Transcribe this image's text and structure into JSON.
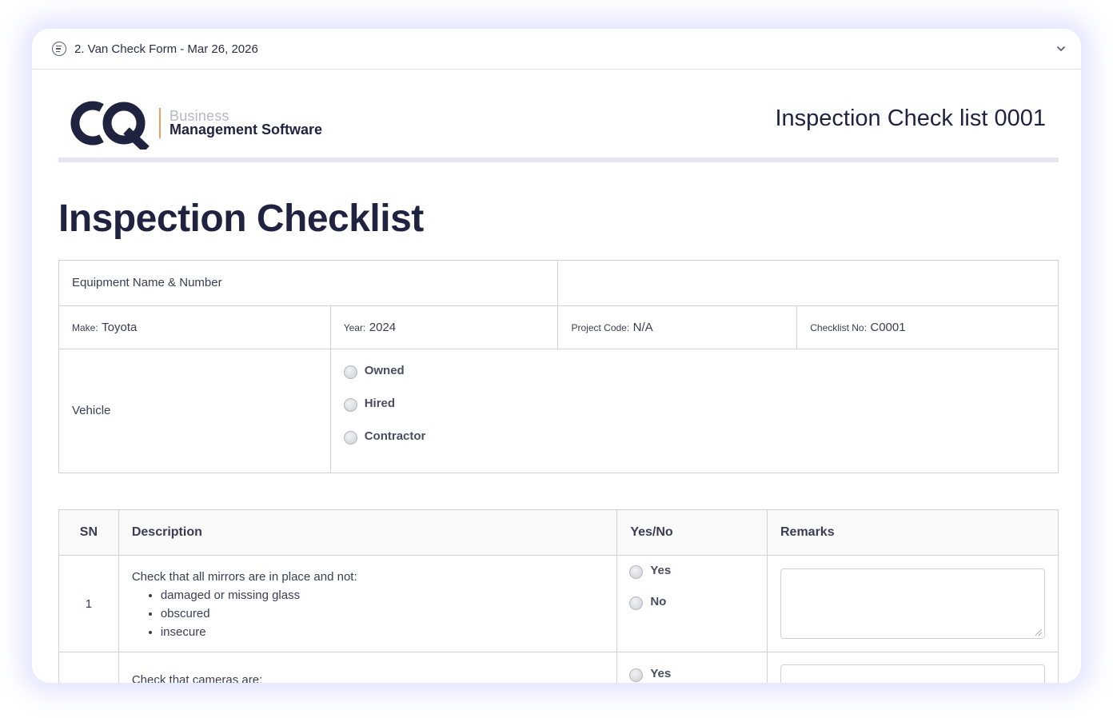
{
  "header": {
    "title": "2. Van Check Form - Mar 26, 2026"
  },
  "brand": {
    "logo_mark": "CQ",
    "line1": "Business",
    "line2": "Management Software",
    "accent_color": "#e8a35a",
    "navy_color": "#1f2340"
  },
  "document": {
    "header_title": "Inspection Check list 0001",
    "title": "Inspection Checklist"
  },
  "info": {
    "equipment_label": "Equipment Name & Number",
    "equipment_value": "",
    "make_label": "Make:",
    "make_value": "Toyota",
    "year_label": "Year:",
    "year_value": "2024",
    "project_label": "Project Code:",
    "project_value": "N/A",
    "checklist_label": "Checklist No:",
    "checklist_value": "C0001",
    "vehicle_label": "Vehicle",
    "vehicle_options": [
      "Owned",
      "Hired",
      "Contractor"
    ]
  },
  "checklist": {
    "headers": {
      "sn": "SN",
      "description": "Description",
      "yesno": "Yes/No",
      "remarks": "Remarks"
    },
    "rows": [
      {
        "sn": "1",
        "intro": "Check that all mirrors are in place and not:",
        "bullets": [
          "damaged or missing glass",
          "obscured",
          "insecure"
        ],
        "yes": "Yes",
        "no": "No"
      },
      {
        "sn": "",
        "intro": "Check that cameras are:",
        "yes": "Yes"
      }
    ]
  }
}
